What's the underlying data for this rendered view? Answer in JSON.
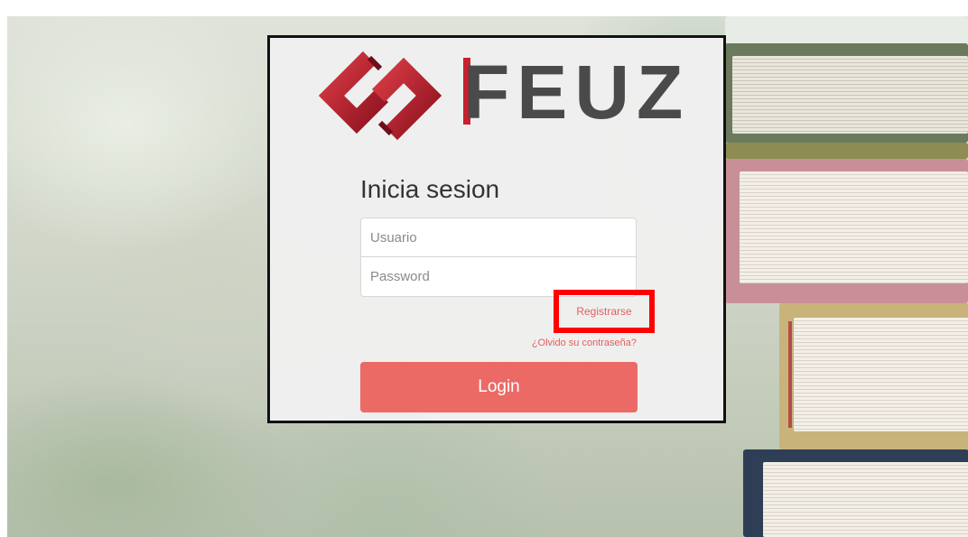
{
  "brand": {
    "name": "FEUZ",
    "accent_color": "#c7202e"
  },
  "login": {
    "title": "Inicia sesion",
    "username_placeholder": "Usuario",
    "password_placeholder": "Password",
    "register_label": "Registrarse",
    "forgot_label": "¿Olvido su contraseña?",
    "submit_label": "Login",
    "button_color": "#ec6a66",
    "link_color": "#e06060"
  },
  "highlight": {
    "color": "#ff0000",
    "target": "Registrarse"
  }
}
